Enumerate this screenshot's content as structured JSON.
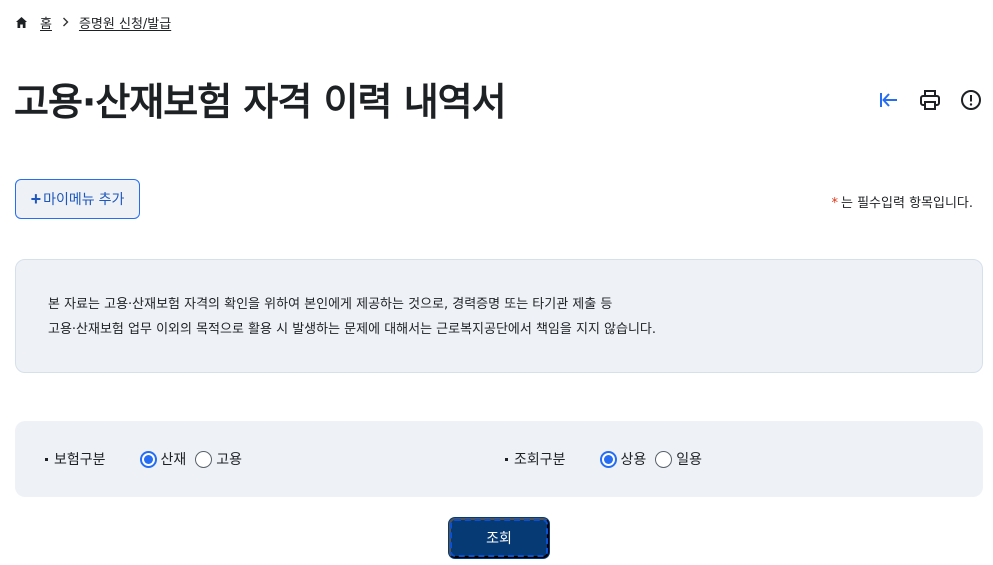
{
  "breadcrumb": {
    "home_label": "홈",
    "current_label": "증명원 신청/발급"
  },
  "page": {
    "title": "고용·산재보험 자격 이력 내역서"
  },
  "tools": [
    "collapse-left-icon",
    "print-icon",
    "info-icon"
  ],
  "mymenu": {
    "label": "마이메뉴 추가"
  },
  "required_note": {
    "star": "*",
    "text": "는 필수입력 항목입니다."
  },
  "notice": {
    "line1": "본 자료는 고용·산재보험 자격의 확인을 위하여 본인에게 제공하는 것으로, 경력증명 또는 타기관 제출 등",
    "line2": "고용·산재보험 업무 이외의 목적으로 활용 시 발생하는 문제에 대해서는 근로복지공단에서 책임을 지지 않습니다."
  },
  "filters": {
    "insurance_type": {
      "label": "보험구분",
      "options": [
        {
          "label": "산재",
          "checked": true
        },
        {
          "label": "고용",
          "checked": false
        }
      ]
    },
    "inquiry_type": {
      "label": "조회구분",
      "options": [
        {
          "label": "상용",
          "checked": true
        },
        {
          "label": "일용",
          "checked": false
        }
      ]
    }
  },
  "search_button": {
    "label": "조회"
  },
  "colors": {
    "primary": "#256ef4",
    "button_dark": "#063a74",
    "panel_bg": "#eef2f7",
    "required": "#de3412"
  }
}
